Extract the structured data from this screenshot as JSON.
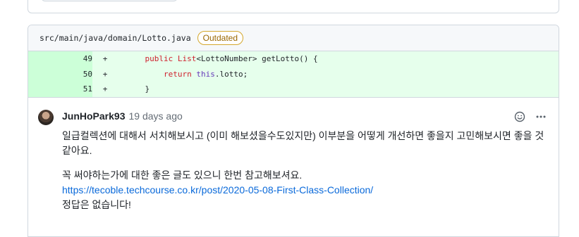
{
  "file": {
    "path": "src/main/java/domain/Lotto.java",
    "status_badge": "Outdated"
  },
  "diff_lines": [
    {
      "number": "49",
      "marker": "+"
    },
    {
      "number": "50",
      "marker": "+"
    },
    {
      "number": "51",
      "marker": "+"
    }
  ],
  "code": {
    "line49": {
      "indent": "    ",
      "kw": "public",
      "type": "List",
      "lt": "<",
      "generic": "LottoNumber",
      "gt": ">",
      "rest": " getLotto() {"
    },
    "line50": {
      "indent": "        ",
      "kw": "return",
      "this": "this",
      "rest": ".lotto;"
    },
    "line51": {
      "indent": "    ",
      "rest": "}"
    }
  },
  "comment": {
    "author": "JunHoPark93",
    "time": "19 days ago",
    "paragraph1": "일급컬렉션에 대해서 서치해보시고 (이미 해보셨을수도있지만) 이부분을 어떻게 개선하면 좋을지 고민해보시면 좋을 것 같아요.",
    "paragraph2_line1": "꼭 써야하는가에 대한 좋은 글도 있으니 한번 참고해보셔요.",
    "link": "https://tecoble.techcourse.co.kr/post/2020-05-08-First-Class-Collection/",
    "paragraph2_line3": "정답은 없습니다!"
  },
  "icons": {
    "reaction": "smiley-icon",
    "more": "kebab-horizontal-icon"
  },
  "colors": {
    "diff_add_bg": "#e6ffec",
    "diff_add_num_bg": "#ccffd8",
    "badge": "#9a6700",
    "link": "#0969da"
  }
}
